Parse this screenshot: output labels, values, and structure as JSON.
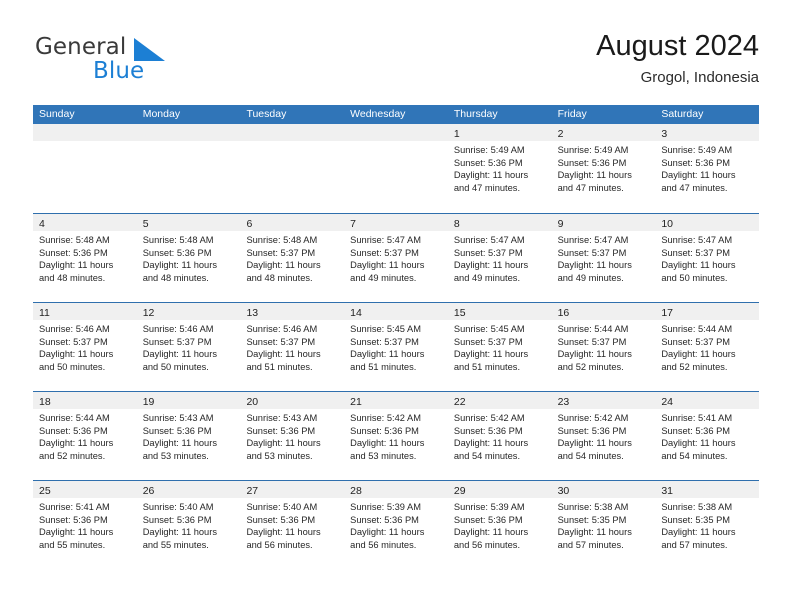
{
  "brand": {
    "name_part1": "General",
    "name_part2": "Blue",
    "flag_color": "#1c7fd4"
  },
  "header": {
    "title": "August 2024",
    "subtitle": "Grogol, Indonesia"
  },
  "theme": {
    "header_blue": "#3075b8",
    "day_band_gray": "#f0f0f0",
    "text": "#272727"
  },
  "calendar": {
    "weekdays": [
      "Sunday",
      "Monday",
      "Tuesday",
      "Wednesday",
      "Thursday",
      "Friday",
      "Saturday"
    ],
    "weeks": [
      [
        {
          "day": "",
          "empty": true
        },
        {
          "day": "",
          "empty": true
        },
        {
          "day": "",
          "empty": true
        },
        {
          "day": "",
          "empty": true
        },
        {
          "day": "1",
          "sunrise": "Sunrise: 5:49 AM",
          "sunset": "Sunset: 5:36 PM",
          "daylight1": "Daylight: 11 hours",
          "daylight2": "and 47 minutes."
        },
        {
          "day": "2",
          "sunrise": "Sunrise: 5:49 AM",
          "sunset": "Sunset: 5:36 PM",
          "daylight1": "Daylight: 11 hours",
          "daylight2": "and 47 minutes."
        },
        {
          "day": "3",
          "sunrise": "Sunrise: 5:49 AM",
          "sunset": "Sunset: 5:36 PM",
          "daylight1": "Daylight: 11 hours",
          "daylight2": "and 47 minutes."
        }
      ],
      [
        {
          "day": "4",
          "sunrise": "Sunrise: 5:48 AM",
          "sunset": "Sunset: 5:36 PM",
          "daylight1": "Daylight: 11 hours",
          "daylight2": "and 48 minutes."
        },
        {
          "day": "5",
          "sunrise": "Sunrise: 5:48 AM",
          "sunset": "Sunset: 5:36 PM",
          "daylight1": "Daylight: 11 hours",
          "daylight2": "and 48 minutes."
        },
        {
          "day": "6",
          "sunrise": "Sunrise: 5:48 AM",
          "sunset": "Sunset: 5:37 PM",
          "daylight1": "Daylight: 11 hours",
          "daylight2": "and 48 minutes."
        },
        {
          "day": "7",
          "sunrise": "Sunrise: 5:47 AM",
          "sunset": "Sunset: 5:37 PM",
          "daylight1": "Daylight: 11 hours",
          "daylight2": "and 49 minutes."
        },
        {
          "day": "8",
          "sunrise": "Sunrise: 5:47 AM",
          "sunset": "Sunset: 5:37 PM",
          "daylight1": "Daylight: 11 hours",
          "daylight2": "and 49 minutes."
        },
        {
          "day": "9",
          "sunrise": "Sunrise: 5:47 AM",
          "sunset": "Sunset: 5:37 PM",
          "daylight1": "Daylight: 11 hours",
          "daylight2": "and 49 minutes."
        },
        {
          "day": "10",
          "sunrise": "Sunrise: 5:47 AM",
          "sunset": "Sunset: 5:37 PM",
          "daylight1": "Daylight: 11 hours",
          "daylight2": "and 50 minutes."
        }
      ],
      [
        {
          "day": "11",
          "sunrise": "Sunrise: 5:46 AM",
          "sunset": "Sunset: 5:37 PM",
          "daylight1": "Daylight: 11 hours",
          "daylight2": "and 50 minutes."
        },
        {
          "day": "12",
          "sunrise": "Sunrise: 5:46 AM",
          "sunset": "Sunset: 5:37 PM",
          "daylight1": "Daylight: 11 hours",
          "daylight2": "and 50 minutes."
        },
        {
          "day": "13",
          "sunrise": "Sunrise: 5:46 AM",
          "sunset": "Sunset: 5:37 PM",
          "daylight1": "Daylight: 11 hours",
          "daylight2": "and 51 minutes."
        },
        {
          "day": "14",
          "sunrise": "Sunrise: 5:45 AM",
          "sunset": "Sunset: 5:37 PM",
          "daylight1": "Daylight: 11 hours",
          "daylight2": "and 51 minutes."
        },
        {
          "day": "15",
          "sunrise": "Sunrise: 5:45 AM",
          "sunset": "Sunset: 5:37 PM",
          "daylight1": "Daylight: 11 hours",
          "daylight2": "and 51 minutes."
        },
        {
          "day": "16",
          "sunrise": "Sunrise: 5:44 AM",
          "sunset": "Sunset: 5:37 PM",
          "daylight1": "Daylight: 11 hours",
          "daylight2": "and 52 minutes."
        },
        {
          "day": "17",
          "sunrise": "Sunrise: 5:44 AM",
          "sunset": "Sunset: 5:37 PM",
          "daylight1": "Daylight: 11 hours",
          "daylight2": "and 52 minutes."
        }
      ],
      [
        {
          "day": "18",
          "sunrise": "Sunrise: 5:44 AM",
          "sunset": "Sunset: 5:36 PM",
          "daylight1": "Daylight: 11 hours",
          "daylight2": "and 52 minutes."
        },
        {
          "day": "19",
          "sunrise": "Sunrise: 5:43 AM",
          "sunset": "Sunset: 5:36 PM",
          "daylight1": "Daylight: 11 hours",
          "daylight2": "and 53 minutes."
        },
        {
          "day": "20",
          "sunrise": "Sunrise: 5:43 AM",
          "sunset": "Sunset: 5:36 PM",
          "daylight1": "Daylight: 11 hours",
          "daylight2": "and 53 minutes."
        },
        {
          "day": "21",
          "sunrise": "Sunrise: 5:42 AM",
          "sunset": "Sunset: 5:36 PM",
          "daylight1": "Daylight: 11 hours",
          "daylight2": "and 53 minutes."
        },
        {
          "day": "22",
          "sunrise": "Sunrise: 5:42 AM",
          "sunset": "Sunset: 5:36 PM",
          "daylight1": "Daylight: 11 hours",
          "daylight2": "and 54 minutes."
        },
        {
          "day": "23",
          "sunrise": "Sunrise: 5:42 AM",
          "sunset": "Sunset: 5:36 PM",
          "daylight1": "Daylight: 11 hours",
          "daylight2": "and 54 minutes."
        },
        {
          "day": "24",
          "sunrise": "Sunrise: 5:41 AM",
          "sunset": "Sunset: 5:36 PM",
          "daylight1": "Daylight: 11 hours",
          "daylight2": "and 54 minutes."
        }
      ],
      [
        {
          "day": "25",
          "sunrise": "Sunrise: 5:41 AM",
          "sunset": "Sunset: 5:36 PM",
          "daylight1": "Daylight: 11 hours",
          "daylight2": "and 55 minutes."
        },
        {
          "day": "26",
          "sunrise": "Sunrise: 5:40 AM",
          "sunset": "Sunset: 5:36 PM",
          "daylight1": "Daylight: 11 hours",
          "daylight2": "and 55 minutes."
        },
        {
          "day": "27",
          "sunrise": "Sunrise: 5:40 AM",
          "sunset": "Sunset: 5:36 PM",
          "daylight1": "Daylight: 11 hours",
          "daylight2": "and 56 minutes."
        },
        {
          "day": "28",
          "sunrise": "Sunrise: 5:39 AM",
          "sunset": "Sunset: 5:36 PM",
          "daylight1": "Daylight: 11 hours",
          "daylight2": "and 56 minutes."
        },
        {
          "day": "29",
          "sunrise": "Sunrise: 5:39 AM",
          "sunset": "Sunset: 5:36 PM",
          "daylight1": "Daylight: 11 hours",
          "daylight2": "and 56 minutes."
        },
        {
          "day": "30",
          "sunrise": "Sunrise: 5:38 AM",
          "sunset": "Sunset: 5:35 PM",
          "daylight1": "Daylight: 11 hours",
          "daylight2": "and 57 minutes."
        },
        {
          "day": "31",
          "sunrise": "Sunrise: 5:38 AM",
          "sunset": "Sunset: 5:35 PM",
          "daylight1": "Daylight: 11 hours",
          "daylight2": "and 57 minutes."
        }
      ]
    ]
  }
}
